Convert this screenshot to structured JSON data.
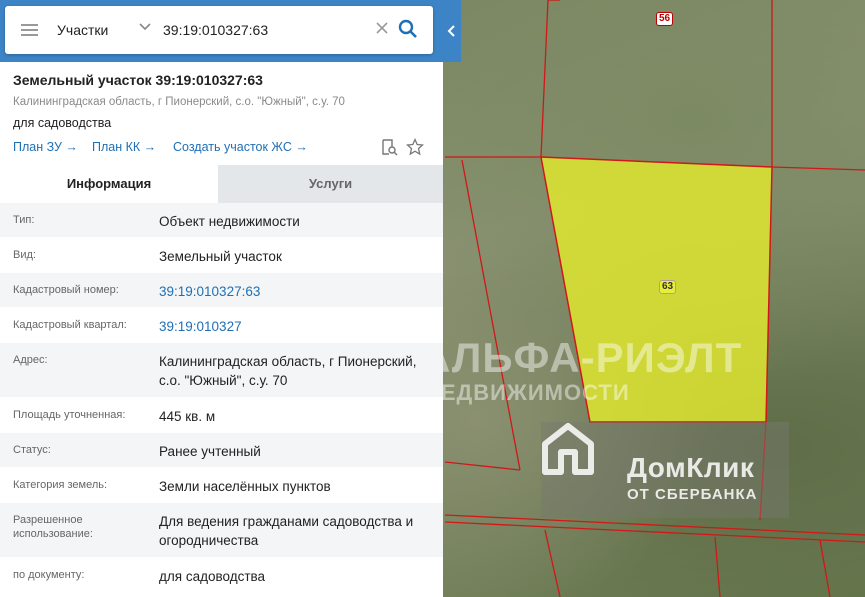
{
  "search": {
    "scope": "Участки",
    "query": "39:19:010327:63"
  },
  "object": {
    "title": "Земельный участок 39:19:010327:63",
    "address_short": "Калининградская область, г Пионерский, с.о. \"Южный\", с.у. 70",
    "use": "для садоводства",
    "links": [
      "План ЗУ →",
      "План КК →",
      "Создать участок ЖС →"
    ]
  },
  "tabs": [
    "Информация",
    "Услуги"
  ],
  "fields": [
    {
      "key": "Тип:",
      "value": "Объект недвижимости"
    },
    {
      "key": "Вид:",
      "value": "Земельный участок"
    },
    {
      "key": "Кадастровый номер:",
      "value": "39:19:010327:63"
    },
    {
      "key": "Кадастровый квартал:",
      "value": "39:19:010327"
    },
    {
      "key": "Адрес:",
      "value": "Калининградская область, г Пионерский, с.о. \"Южный\", с.у. 70"
    },
    {
      "key": "Площадь уточненная:",
      "value": "445 кв. м"
    },
    {
      "key": "Статус:",
      "value": "Ранее учтенный"
    },
    {
      "key": "Категория земель:",
      "value": "Земли населённых пунктов"
    },
    {
      "key": "Разрешенное использование:",
      "value": "Для ведения гражданами садоводства и огородничества"
    },
    {
      "key": "по документу:",
      "value": "для садоводства"
    }
  ],
  "map": {
    "parcel_labels": [
      "56",
      "63"
    ],
    "highlight_color": "#e3ea2e",
    "boundary_color": "#d01818",
    "watermark_line1": "АЛЬФА-РИЭЛТ",
    "watermark_line2": "НЕДВИЖИМОСТИ",
    "logo_title": "ДомКлик",
    "logo_subtitle": "ОТ СБЕРБАНКА"
  },
  "colors": {
    "accent": "#3d84c6",
    "link": "#1f6fb6"
  },
  "icons": [
    "menu-icon",
    "chevron-down-icon",
    "close-icon",
    "search-icon",
    "chevron-left-icon",
    "document-search-icon",
    "star-icon"
  ]
}
